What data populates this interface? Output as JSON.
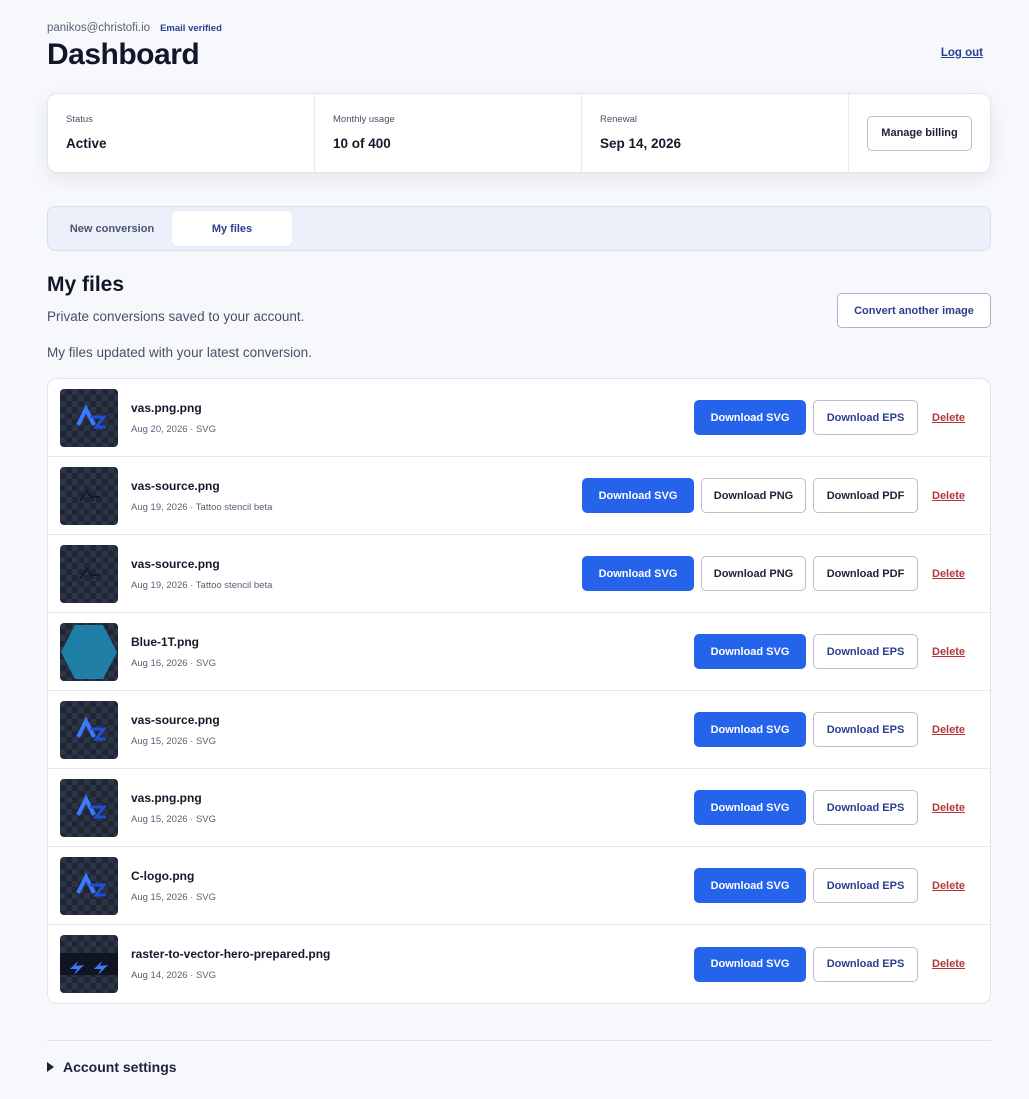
{
  "header": {
    "email": "panikos@christofi.io",
    "email_badge": "Email verified",
    "title": "Dashboard",
    "logout": "Log out"
  },
  "status": {
    "items": [
      {
        "label": "Status",
        "value": "Active"
      },
      {
        "label": "Monthly usage",
        "value": "10 of 400"
      },
      {
        "label": "Renewal",
        "value": "Sep 14, 2026"
      }
    ],
    "manage_billing": "Manage billing"
  },
  "tabs": [
    {
      "label": "New conversion",
      "active": false
    },
    {
      "label": "My files",
      "active": true
    }
  ],
  "files_section": {
    "title": "My files",
    "subtitle": "Private conversions saved to your account.",
    "convert_button": "Convert another image",
    "update_message": "My files updated with your latest conversion."
  },
  "files": [
    {
      "name": "vas.png.png",
      "meta": "Aug 20, 2026 · SVG",
      "thumb": "logo-icon",
      "buttons": [
        "Download SVG",
        "Download EPS"
      ],
      "delete": "Delete"
    },
    {
      "name": "vas-source.png",
      "meta": "Aug 19, 2026 · Tattoo stencil beta",
      "thumb": "stencil-icon",
      "buttons": [
        "Download SVG",
        "Download PNG",
        "Download PDF"
      ],
      "delete": "Delete"
    },
    {
      "name": "vas-source.png",
      "meta": "Aug 19, 2026 · Tattoo stencil beta",
      "thumb": "stencil-icon",
      "buttons": [
        "Download SVG",
        "Download PNG",
        "Download PDF"
      ],
      "delete": "Delete"
    },
    {
      "name": "Blue-1T.png",
      "meta": "Aug 16, 2026 · SVG",
      "thumb": "hexagon-icon",
      "buttons": [
        "Download SVG",
        "Download EPS"
      ],
      "delete": "Delete"
    },
    {
      "name": "vas-source.png",
      "meta": "Aug 15, 2026 · SVG",
      "thumb": "logo-icon",
      "buttons": [
        "Download SVG",
        "Download EPS"
      ],
      "delete": "Delete"
    },
    {
      "name": "vas.png.png",
      "meta": "Aug 15, 2026 · SVG",
      "thumb": "logo-icon",
      "buttons": [
        "Download SVG",
        "Download EPS"
      ],
      "delete": "Delete"
    },
    {
      "name": "C-logo.png",
      "meta": "Aug 15, 2026 · SVG",
      "thumb": "logo-icon",
      "buttons": [
        "Download SVG",
        "Download EPS"
      ],
      "delete": "Delete"
    },
    {
      "name": "raster-to-vector-hero-prepared.png",
      "meta": "Aug 14, 2026 · SVG",
      "thumb": "lightning-icon",
      "buttons": [
        "Download SVG",
        "Download EPS"
      ],
      "delete": "Delete"
    }
  ],
  "account_settings": "Account settings",
  "colors": {
    "primary": "#2563eb",
    "accent_text": "#2a3f8f",
    "danger": "#b3373b",
    "page_bg": "#f6f8fc"
  }
}
